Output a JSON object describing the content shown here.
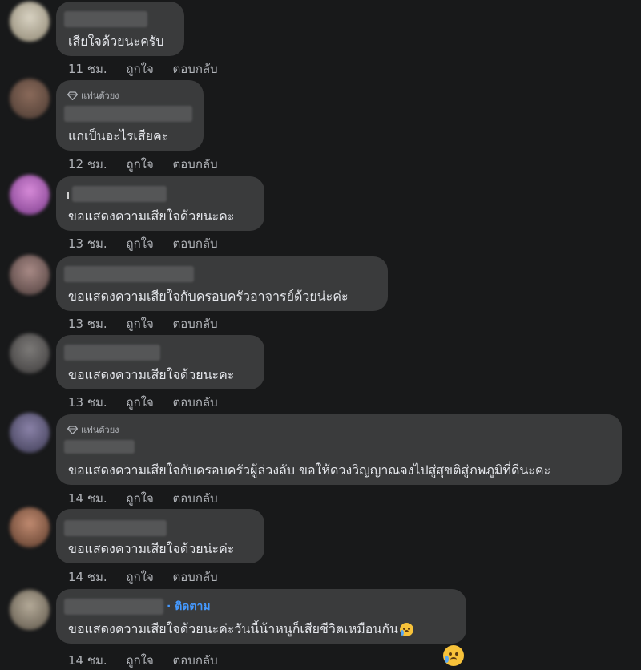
{
  "comments": [
    {
      "text": "เสียใจด้วยนะครับ",
      "time": "11 ชม.",
      "like": "ถูกใจ",
      "reply": "ตอบกลับ",
      "badge": "",
      "follow": ""
    },
    {
      "text": "แกเป็นอะไรเสียคะ",
      "time": "12 ชม.",
      "like": "ถูกใจ",
      "reply": "ตอบกลับ",
      "badge": "แฟนตัวยง",
      "follow": ""
    },
    {
      "text": "ขอแสดงความเสียใจด้วยนะคะ",
      "time": "13 ชม.",
      "like": "ถูกใจ",
      "reply": "ตอบกลับ",
      "badge": "",
      "follow": ""
    },
    {
      "text": "ขอแสดงความเสียใจกับครอบครัวอาจารย์ด้วยน่ะค่ะ",
      "time": "13 ชม.",
      "like": "ถูกใจ",
      "reply": "ตอบกลับ",
      "badge": "",
      "follow": ""
    },
    {
      "text": "ขอแสดงความเสียใจด้วยนะคะ",
      "time": "13 ชม.",
      "like": "ถูกใจ",
      "reply": "ตอบกลับ",
      "badge": "",
      "follow": ""
    },
    {
      "text": "ขอแสดงความเสียใจกับครอบครัวผู้ล่วงลับ ขอให้ดวงวิญญาณจงไปสู่สุขติสู่ภพภูมิที่ดีนะคะ",
      "time": "14 ชม.",
      "like": "ถูกใจ",
      "reply": "ตอบกลับ",
      "badge": "แฟนตัวยง",
      "follow": ""
    },
    {
      "text": "ขอแสดงความเสียใจด้วยน่ะค่ะ",
      "time": "14 ชม.",
      "like": "ถูกใจ",
      "reply": "ตอบกลับ",
      "badge": "",
      "follow": ""
    },
    {
      "text": "ขอแสดงความเสียใจด้วยนะค่ะวันนี้น้าหนูก็เสียชีวิตเหมือนกัน",
      "time": "14 ชม.",
      "like": "ถูกใจ",
      "reply": "ตอบกลับ",
      "badge": "",
      "follow": "· ติดตาม"
    }
  ],
  "colors": {
    "background": "#18191a",
    "bubble": "#3a3b3c",
    "text": "#e4e6eb",
    "secondary_text": "#b0b3b8",
    "follow_link": "#4599ff"
  },
  "icons": {
    "badge": "diamond-icon",
    "reaction": "crying-face-emoji"
  }
}
